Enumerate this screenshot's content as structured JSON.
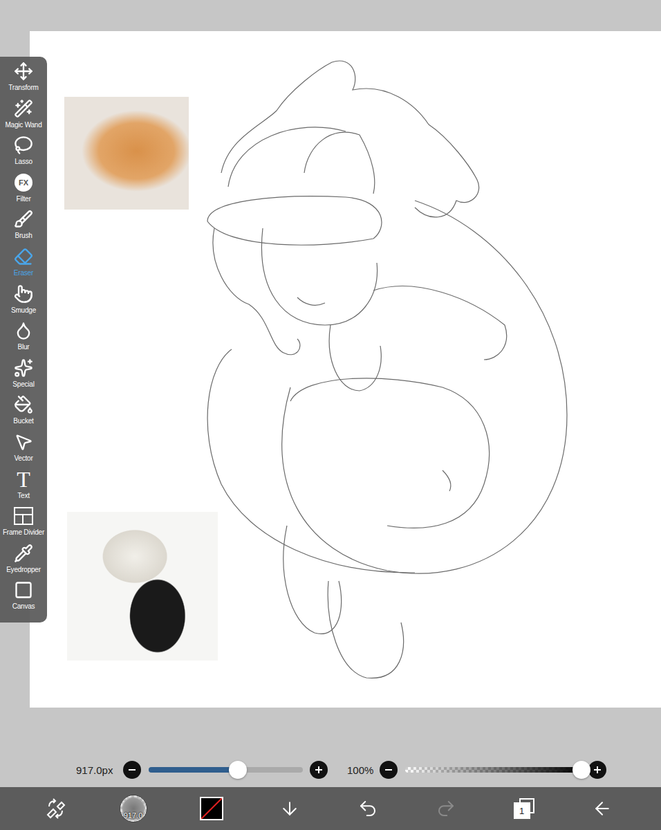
{
  "toolbar": {
    "tools": [
      {
        "label": "Transform",
        "selected": false
      },
      {
        "label": "Magic Wand",
        "selected": false
      },
      {
        "label": "Lasso",
        "selected": false
      },
      {
        "label": "Filter",
        "selected": false,
        "glyph": "FX"
      },
      {
        "label": "Brush",
        "selected": false
      },
      {
        "label": "Eraser",
        "selected": true
      },
      {
        "label": "Smudge",
        "selected": false
      },
      {
        "label": "Blur",
        "selected": false
      },
      {
        "label": "Special",
        "selected": false
      },
      {
        "label": "Bucket",
        "selected": false
      },
      {
        "label": "Vector",
        "selected": false
      },
      {
        "label": "Text",
        "selected": false,
        "glyph": "T"
      },
      {
        "label": "Frame Divider",
        "selected": false
      },
      {
        "label": "Eyedropper",
        "selected": false
      },
      {
        "label": "Canvas",
        "selected": false
      }
    ]
  },
  "brush_bar": {
    "size": {
      "reading": "917.0px",
      "level": 0.58
    },
    "opacity": {
      "reading": "100%",
      "level": 1.0
    }
  },
  "bottom_bar": {
    "brush_preview": "917.0",
    "current_color": "#000000",
    "layer_count": "1",
    "undo_enabled": true,
    "redo_enabled": false
  }
}
